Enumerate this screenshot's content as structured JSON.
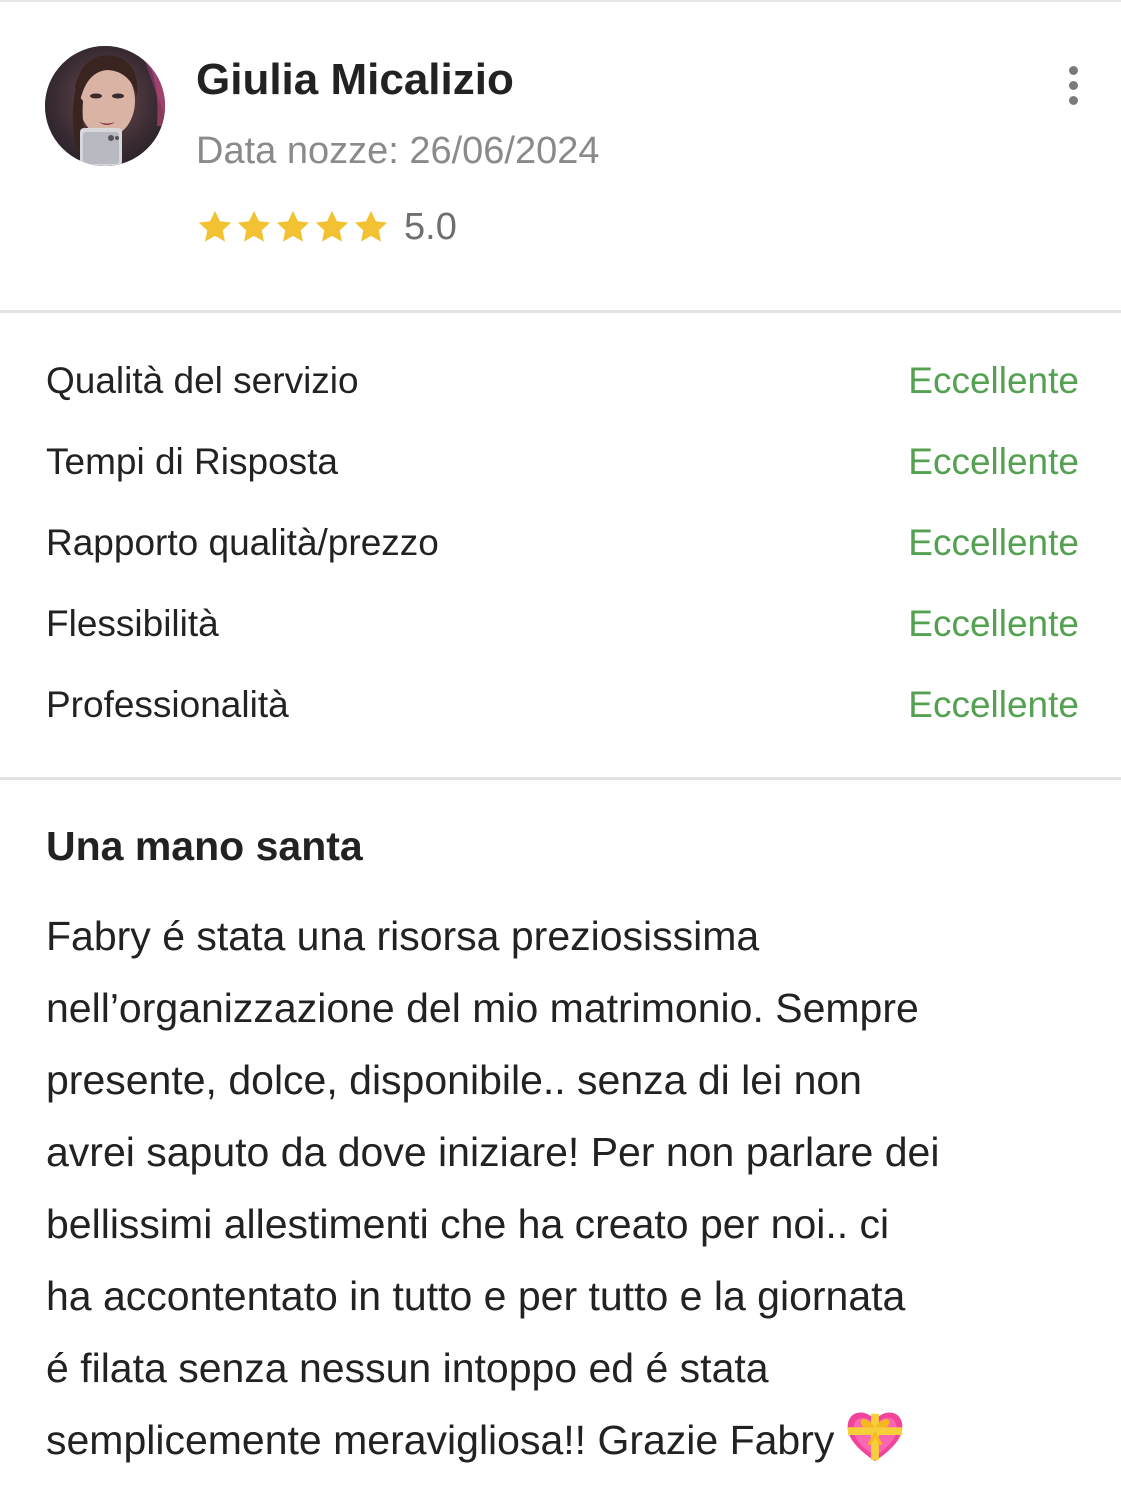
{
  "review": {
    "author": {
      "name": "Giulia Micalizio",
      "wedding_date": "Data nozze: 26/06/2024",
      "avatar_icon": "user-avatar-photo"
    },
    "rating": {
      "stars_filled": 5,
      "stars_total": 5,
      "value": "5.0",
      "star_color": "#f2c233"
    },
    "more_icon": "vertical-ellipsis-icon"
  },
  "ratings": [
    {
      "label": "Qualità del servizio",
      "value": "Eccellente"
    },
    {
      "label": "Tempi di Risposta",
      "value": "Eccellente"
    },
    {
      "label": "Rapporto qualità/prezzo",
      "value": "Eccellente"
    },
    {
      "label": "Flessibilità",
      "value": "Eccellente"
    },
    {
      "label": "Professionalità",
      "value": "Eccellente"
    }
  ],
  "rating_value_color": "#55a152",
  "review_text": {
    "title": "Una mano santa",
    "lines": [
      "Fabry é stata una risorsa preziosissima",
      "nell’organizzazione del mio matrimonio. Sempre",
      "presente, dolce, disponibile.. senza di lei non",
      "avrei saputo da dove iniziare! Per non parlare dei",
      "bellissimi allestimenti che ha creato per noi.. ci",
      "ha accontentato in tutto e per tutto e la giornata",
      "é filata senza nessun intoppo ed é stata",
      "semplicemente meravigliosa!! Grazie Fabry"
    ],
    "trailing_emoji": "heart-with-ribbon-icon"
  }
}
